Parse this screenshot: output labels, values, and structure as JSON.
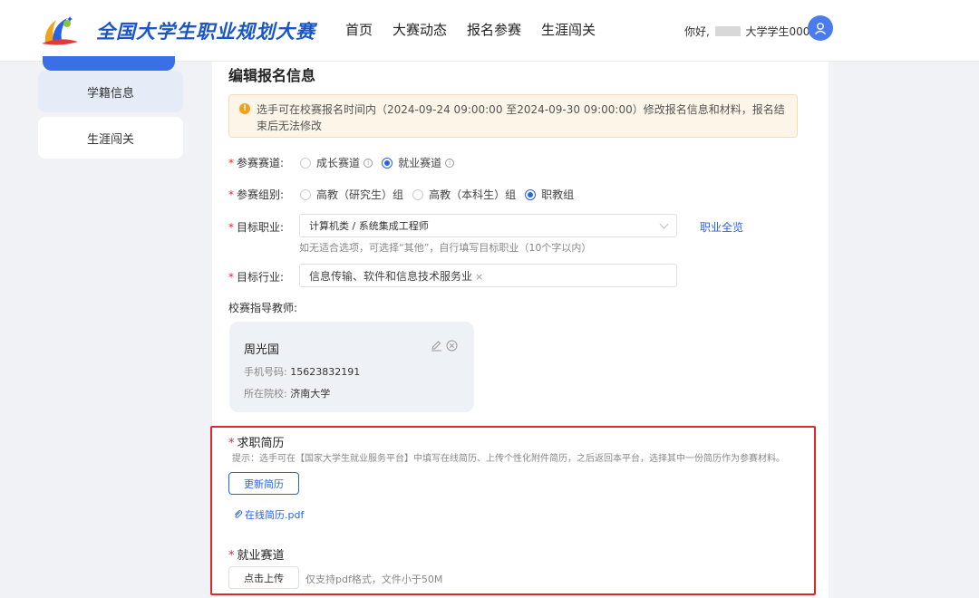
{
  "header": {
    "title": "全国大学生职业规划大赛",
    "nav": [
      "首页",
      "大赛动态",
      "报名参赛",
      "生涯闯关"
    ],
    "greeting_prefix": "你好,",
    "greeting_user": "大学学生0001",
    "avatar_icon": "user-icon"
  },
  "sidebar": {
    "items": [
      {
        "label": "学籍信息",
        "active": true
      },
      {
        "label": "生涯闯关",
        "active": false
      }
    ]
  },
  "page": {
    "title": "编辑报名信息",
    "notice": "选手可在校赛报名时间内（2024-09-24 09:00:00 至2024-09-30 09:00:00）修改报名信息和材料，报名结束后无法修改"
  },
  "form": {
    "track": {
      "label": "参赛赛道:",
      "options": [
        {
          "label": "成长赛道",
          "checked": false
        },
        {
          "label": "就业赛道",
          "checked": true
        }
      ]
    },
    "group": {
      "label": "参赛组别:",
      "options": [
        {
          "label": "高教（研究生）组",
          "checked": false
        },
        {
          "label": "高教（本科生）组",
          "checked": false
        },
        {
          "label": "职教组",
          "checked": true
        }
      ]
    },
    "career": {
      "label": "目标职业:",
      "value": "计算机类 / 系统集成工程师",
      "link": "职业全览",
      "hint": "如无适合选项，可选择“其他”，自行填写目标职业（10个字以内）"
    },
    "industry": {
      "label": "目标行业:",
      "tag": "信息传输、软件和信息技术服务业",
      "tag_close": "×"
    },
    "teacher": {
      "label": "校赛指导教师:",
      "name": "周光国",
      "phone_label": "手机号码:",
      "phone": "15623832191",
      "school_label": "所在院校:",
      "school": "济南大学"
    },
    "resume": {
      "title": "求职简历",
      "hint": "提示：选手可在【国家大学生就业服务平台】中填写在线简历、上传个性化附件简历，之后返回本平台，选择其中一份简历作为参赛材料。",
      "button": "更新简历",
      "file": "在线简历.pdf"
    },
    "employment": {
      "title": "就业赛道",
      "button": "点击上传",
      "hint": "仅支持pdf格式，文件小于50M"
    }
  },
  "colors": {
    "brand": "#1a56c4",
    "primary": "#2a62e6",
    "highlight": "#e02828",
    "notice_bg": "#fdf6e8"
  }
}
